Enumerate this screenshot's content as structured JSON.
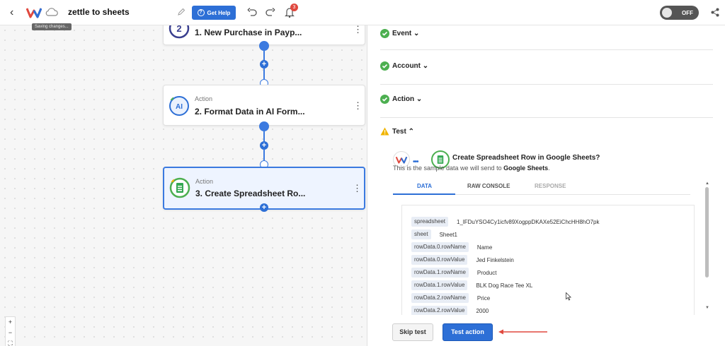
{
  "topbar": {
    "title": "zettle to sheets",
    "saving_tooltip": "Saving changes...",
    "help_label": "Get Help",
    "notification_count": "3",
    "toggle_label": "OFF"
  },
  "flow": {
    "nodes": [
      {
        "kind": "",
        "name": "1. New Purchase in Payp..."
      },
      {
        "kind": "Action",
        "name": "2. Format Data in AI Form..."
      },
      {
        "kind": "Action",
        "name": "3. Create Spreadsheet Ro..."
      }
    ],
    "zoom_controls": {
      "zoom_in": "+",
      "zoom_out": "−"
    }
  },
  "panel": {
    "sections": [
      {
        "label": "Event",
        "status": "complete"
      },
      {
        "label": "Account",
        "status": "complete"
      },
      {
        "label": "Action",
        "status": "complete"
      },
      {
        "label": "Test",
        "status": "warning"
      }
    ],
    "test": {
      "title": "Create Spreadsheet Row in Google Sheets?",
      "subtitle_prefix": "This is the sample data we will send to ",
      "subtitle_app": "Google Sheets",
      "subtitle_suffix": ".",
      "tabs": [
        "DATA",
        "RAW CONSOLE",
        "RESPONSE"
      ],
      "rows": [
        {
          "key": "spreadsheet",
          "value": "1_lFDuYSO4Cy1icfv89XogppDKAXe52EiChcHH8hO7pk"
        },
        {
          "key": "sheet",
          "value": "Sheet1"
        },
        {
          "key": "rowData.0.rowName",
          "value": "Name"
        },
        {
          "key": "rowData.0.rowValue",
          "value": "Jed Finkelstein"
        },
        {
          "key": "rowData.1.rowName",
          "value": "Product"
        },
        {
          "key": "rowData.1.rowValue",
          "value": "BLK Dog Race Tee XL"
        },
        {
          "key": "rowData.2.rowName",
          "value": "Price"
        },
        {
          "key": "rowData.2.rowValue",
          "value": "2000"
        }
      ],
      "skip_label": "Skip test",
      "test_label": "Test action"
    }
  },
  "colors": {
    "accent": "#2d6fd6",
    "success": "#4caf50",
    "warning": "#f0b400",
    "annotation_arrow": "#e0483e"
  }
}
